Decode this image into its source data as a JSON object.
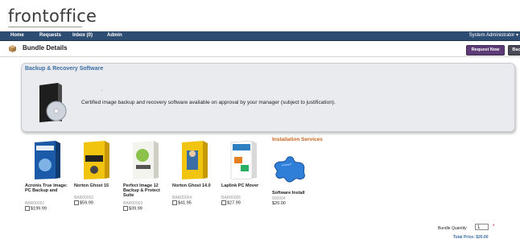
{
  "app": {
    "logo": "frontoffice"
  },
  "nav": {
    "items": [
      "Home",
      "Requests",
      "Inbox (0)",
      "Admin"
    ],
    "user": "System Administrator"
  },
  "page": {
    "title": "Bundle Details",
    "request_button": "Request Now",
    "back_button": "Back"
  },
  "bundle": {
    "title": "Backup & Recovery Software",
    "dot": ".",
    "description": "Certified image backup and recovery software available on approval by your manager (subject to justification)."
  },
  "products": [
    {
      "name": "Acronis True Image: PC Backup and",
      "code": "BAR00001",
      "price": "$199.99"
    },
    {
      "name": "Norton Ghost 15",
      "code": "BAR00002",
      "price": "$59.99"
    },
    {
      "name": "Perfect Image 12 Backup & Protect Suite",
      "code": "BAR00003",
      "price": "$39.99"
    },
    {
      "name": "Norton Ghost 14.0",
      "code": "BAR00004",
      "price": "$41.95"
    },
    {
      "name": "Laplink PC Mover",
      "code": "BAR00005",
      "price": "$27.99"
    }
  ],
  "services": {
    "title": "Installation Services",
    "name": "Software Install",
    "code": "900004",
    "price": "$20.00"
  },
  "footer": {
    "qty_label": "Bundle Quantity",
    "qty_value": "1",
    "required_mark": "*",
    "total": "Total Price: $20.00"
  },
  "colors": {
    "nav_bg": "#2e4d73",
    "accent_blue": "#3b6ea5",
    "services_orange": "#c8641e",
    "request_button": "#5c3b76"
  }
}
